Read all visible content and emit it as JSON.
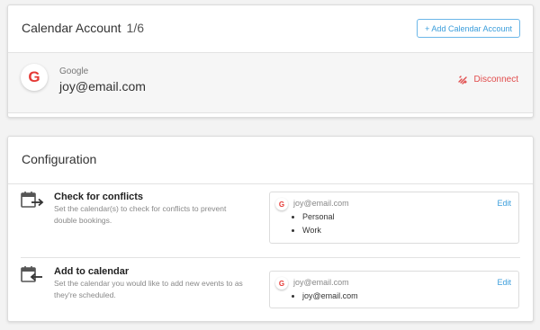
{
  "accounts": {
    "title": "Calendar Account",
    "count": "1/6",
    "add_button": "+ Add Calendar Account",
    "items": [
      {
        "provider": "Google",
        "provider_icon": "google-g-icon",
        "email": "joy@email.com",
        "disconnect": "Disconnect"
      }
    ]
  },
  "config": {
    "title": "Configuration",
    "sections": [
      {
        "title": "Check for conflicts",
        "description": "Set the calendar(s) to check for conflicts to prevent double bookings.",
        "icon": "calendar-export-icon",
        "email": "joy@email.com",
        "edit": "Edit",
        "calendars": [
          "Personal",
          "Work"
        ]
      },
      {
        "title": "Add to calendar",
        "description": "Set the calendar you would like to add new events to as they're scheduled.",
        "icon": "calendar-import-icon",
        "email": "joy@email.com",
        "edit": "Edit",
        "calendars": [
          "joy@email.com"
        ]
      }
    ]
  },
  "colors": {
    "accent": "#3a9ddb",
    "danger": "#e14c4c",
    "google_red": "#e53935"
  }
}
